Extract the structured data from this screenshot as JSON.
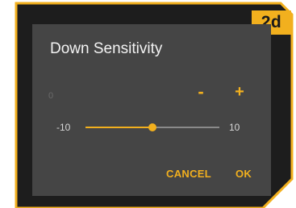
{
  "colors": {
    "frame": "#1d1d1d",
    "frame_border": "#f2b01e",
    "dialog": "#454545",
    "accent": "#f2b01e"
  },
  "badge": {
    "label": "2d"
  },
  "dialog": {
    "title": "Down Sensitivity",
    "current_value": "0",
    "minus_label": "-",
    "plus_label": "+",
    "slider": {
      "min_label": "-10",
      "max_label": "10",
      "min": -10,
      "max": 10,
      "value": 0
    },
    "cancel_label": "CANCEL",
    "ok_label": "OK"
  }
}
